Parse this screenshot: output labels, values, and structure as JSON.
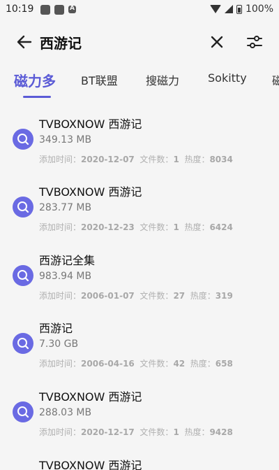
{
  "status": {
    "time": "10:19",
    "battery": "100%"
  },
  "search": {
    "query": "西游记"
  },
  "tabs": [
    {
      "label": "磁力多",
      "active": true
    },
    {
      "label": "BT联盟",
      "active": false
    },
    {
      "label": "搜磁力",
      "active": false
    },
    {
      "label": "Sokitty",
      "active": false
    },
    {
      "label": "磁",
      "active": false
    }
  ],
  "meta_labels": {
    "added": "添加时间：",
    "files": "文件数：",
    "heat": "热度："
  },
  "results": [
    {
      "title": "TVBOXNOW 西游记",
      "size": "349.13 MB",
      "date": "2020-12-07",
      "files": "1",
      "heat": "8034"
    },
    {
      "title": "TVBOXNOW 西游记",
      "size": "283.77 MB",
      "date": "2020-12-23",
      "files": "1",
      "heat": "6424"
    },
    {
      "title": "西游记全集",
      "size": "983.94 MB",
      "date": "2006-01-07",
      "files": "27",
      "heat": "319"
    },
    {
      "title": "西游记",
      "size": "7.30 GB",
      "date": "2006-04-16",
      "files": "42",
      "heat": "658"
    },
    {
      "title": "TVBOXNOW 西游记",
      "size": "288.03 MB",
      "date": "2020-12-17",
      "files": "1",
      "heat": "9428"
    },
    {
      "title": "TVBOXNOW 西游记",
      "size": "",
      "date": "",
      "files": "",
      "heat": ""
    }
  ],
  "colors": {
    "accent": "#5b5bd6",
    "icon_bg": "#6a6ae3",
    "background": "#f5f5f5"
  }
}
